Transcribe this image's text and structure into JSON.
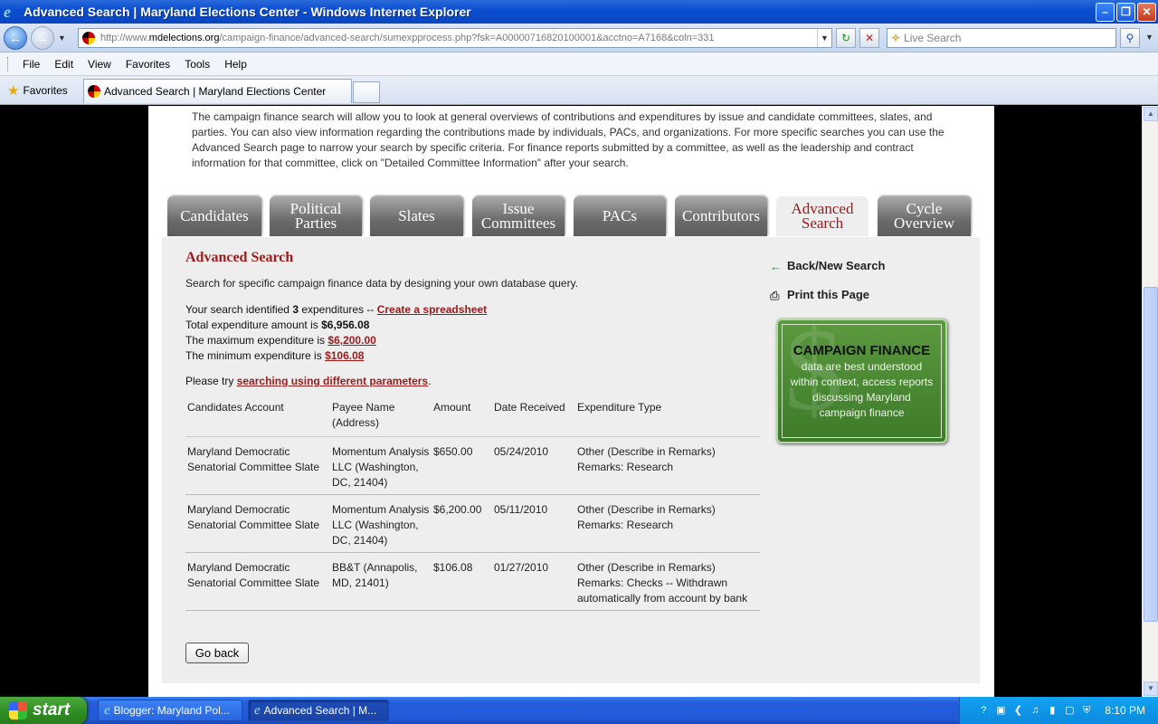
{
  "window": {
    "title": "Advanced Search | Maryland Elections Center - Windows Internet Explorer",
    "min_glyph": "–",
    "max_glyph": "❐",
    "close_glyph": "✕"
  },
  "addressbar": {
    "url_prefix": "http://www.",
    "url_host": "mdelections.org",
    "url_rest": "/campaign-finance/advanced-search/sumexpprocess.php?fsk=A00000716820100001&acctno=A7168&coln=331",
    "search_placeholder": "Live Search",
    "search_logo": "✧"
  },
  "menu": [
    "File",
    "Edit",
    "View",
    "Favorites",
    "Tools",
    "Help"
  ],
  "favorites": {
    "label": "Favorites",
    "tab_title": "Advanced Search | Maryland Elections Center"
  },
  "intro": "The campaign finance search will allow you to look at general overviews of contributions and expenditures by issue and candidate committees, slates, and parties. You can also view information regarding the contributions made by individuals, PACs, and organizations. For more specific searches you can use the Advanced Search page to narrow your search by specific criteria. For finance reports submitted by a committee, as well as the leadership and contract information for that committee, click on \"Detailed Committee Information\" after your search.",
  "nav_tabs": [
    {
      "line1": "Candidates",
      "line2": ""
    },
    {
      "line1": "Political",
      "line2": "Parties"
    },
    {
      "line1": "Slates",
      "line2": ""
    },
    {
      "line1": "Issue",
      "line2": "Committees"
    },
    {
      "line1": "PACs",
      "line2": ""
    },
    {
      "line1": "Contributors",
      "line2": ""
    },
    {
      "line1": "Advanced",
      "line2": "Search"
    },
    {
      "line1": "Cycle",
      "line2": "Overview"
    }
  ],
  "panel": {
    "heading": "Advanced Search",
    "description": "Search for specific campaign finance data by designing your own database query.",
    "result_prefix": "Your search identified ",
    "result_count": "3",
    "result_suffix": " expenditures -- ",
    "spreadsheet_link": "Create a spreadsheet",
    "total_label": "Total expenditure amount is ",
    "total_value": "$6,956.08",
    "max_label": "The maximum expenditure is ",
    "max_value": "$6,200.00",
    "min_label": "The minimum expenditure is ",
    "min_value": "$106.08",
    "retry_prefix": "Please try ",
    "retry_link": "searching using different parameters",
    "retry_suffix": ".",
    "go_back": "Go back"
  },
  "table": {
    "headers": [
      "Candidates Account",
      "Payee Name (Address)",
      "Amount",
      "Date Received",
      "Expenditure Type"
    ],
    "rows": [
      [
        "Maryland Democratic Senatorial Committee Slate",
        "Momentum Analysis LLC (Washington, DC, 21404)",
        "$650.00",
        "05/24/2010",
        "Other (Describe in Remarks) Remarks: Research"
      ],
      [
        "Maryland Democratic Senatorial Committee Slate",
        "Momentum Analysis LLC (Washington, DC, 21404)",
        "$6,200.00",
        "05/11/2010",
        "Other (Describe in Remarks) Remarks: Research"
      ],
      [
        "Maryland Democratic Senatorial Committee Slate",
        "BB&T (Annapolis, MD, 21401)",
        "$106.08",
        "01/27/2010",
        "Other (Describe in Remarks) Remarks: Checks -- Withdrawn automatically from account by bank"
      ]
    ]
  },
  "sidebar": {
    "back_new_search": "Back/New Search",
    "print_page": "Print this Page",
    "promo_title": "CAMPAIGN FINANCE",
    "promo_text": "data are best understood within context, access reports discussing Maryland campaign finance"
  },
  "taskbar": {
    "start": "start",
    "items": [
      "Blogger: Maryland Pol...",
      "Advanced Search | M..."
    ],
    "clock": "8:10 PM"
  }
}
